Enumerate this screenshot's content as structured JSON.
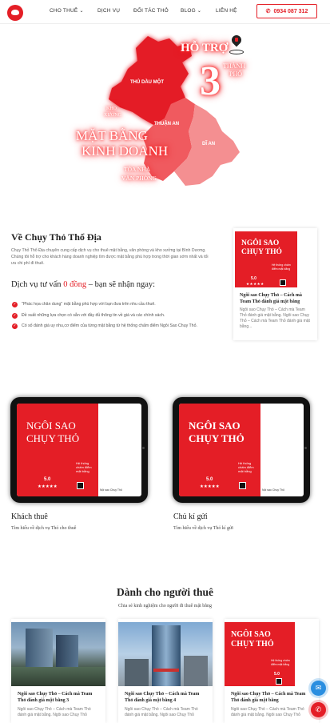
{
  "nav": {
    "items": [
      "CHO THUÊ",
      "DỊCH VỤ",
      "ĐỐI TÁC THỎ",
      "BLOG",
      "LIÊN HỆ"
    ],
    "phone": "0934 087 312"
  },
  "hero": {
    "support_word": "HỖ TRỢ",
    "number": "3",
    "thanh": "THÀNH",
    "pho": "PHỐ",
    "kho": "KHO",
    "xuong": "XƯỞNG",
    "mat_bang": "MẶT BẰNG",
    "kinh_doanh": "KINH DOANH",
    "toa_nha": "TÒA NHÀ",
    "van_phong": "VĂN PHÒNG",
    "regions": [
      "THỦ DẦU MỘT",
      "THUẬN AN",
      "DĨ AN"
    ],
    "colors": {
      "region1": "#e41e26",
      "region2": "#f05a5f",
      "region3": "#f48f91"
    }
  },
  "about": {
    "title": "Về Chụy Thỏ Thổ Địa",
    "text": "Chụy Thỏ Thổ Địa chuyên cung cấp dịch vụ cho thuê mặt bằng, văn phòng và kho xưởng tại Bình Dương. Chúng tôi hỗ trợ cho khách hàng doanh nghiệp tìm được mặt bằng phù hợp trong thời gian sớm nhất và tối ưu chi phí đi thuê.",
    "consult_prefix": "Dịch vụ tư vấn",
    "consult_free": "0 đồng",
    "consult_suffix": "– bạn sẽ nhận ngay:",
    "bullets": [
      "\"Phác họa chân dung\" mặt bằng phù hợp với bạn đưa trên nhu cầu thuê.",
      "Đề xuất những lựa chọn có sẵn với đầy đủ thông tin về giá và các chính sách.",
      "Có số đánh giá uy nhu,cơ điểm của từng mặt bằng từ hệ thống chấm điểm Ngôi Sao Chụy Thỏ."
    ]
  },
  "card": {
    "line1": "NGÔI SAO",
    "line2": "CHỤY THỎ",
    "sub": "Hệ thống chấm điểm mặt bằng",
    "rating": "5.0",
    "stars": "★★★★★"
  },
  "side_post": {
    "title": "Ngôi sao Chụy Thỏ – Cách mà Team Thỏ đánh giá mặt bằng",
    "excerpt": "Ngôi sao Chụy Thỏ – Cách mà Team Thỏ đánh giá mặt bằng. Ngôi sao Chụy Thỏ – Cách mà Team Thỏ đánh giá mặt bằng..."
  },
  "tablets": [
    {
      "heading": "Khách thuê",
      "link": "Tìm hiểu về dịch vụ Thỏ cho thuê"
    },
    {
      "heading": "Chủ kí gửi",
      "link": "Tìm hiểu về dịch vụ Thỏ kí gửi"
    }
  ],
  "tablet_screen_link": "Nội sao Chụy Thỏ",
  "renters": {
    "title": "Dành cho người thuê",
    "subtitle": "Chia sẻ kinh nghiệm cho người đi thuê mặt bằng",
    "posts": [
      {
        "title": "Ngôi sao Chụy Thỏ – Cách mà Team Thỏ đánh giá mặt bằng 3",
        "excerpt": "Ngôi sao Chụy Thỏ – Cách mà Team Thỏ đánh giá mặt bằng. Ngôi sao Chụy Thỏ"
      },
      {
        "title": "Ngôi sao Chụy Thỏ – Cách mà Team Thỏ đánh giá mặt bằng 4",
        "excerpt": "Ngôi sao Chụy Thỏ – Cách mà Team Thỏ đánh giá mặt bằng. Ngôi sao Chụy Thỏ"
      },
      {
        "title": "Ngôi sao Chụy Thỏ – Cách mà Team Thỏ đánh giá mặt bằng",
        "excerpt": "Ngôi sao Chụy Thỏ – Cách mà Team Thỏ đánh giá mặt bằng. Ngôi sao Chụy Thỏ"
      }
    ]
  },
  "icons": {
    "phone": "phone-icon",
    "messenger": "messenger-icon",
    "call": "call-icon",
    "map_pin": "map-pin-icon"
  }
}
